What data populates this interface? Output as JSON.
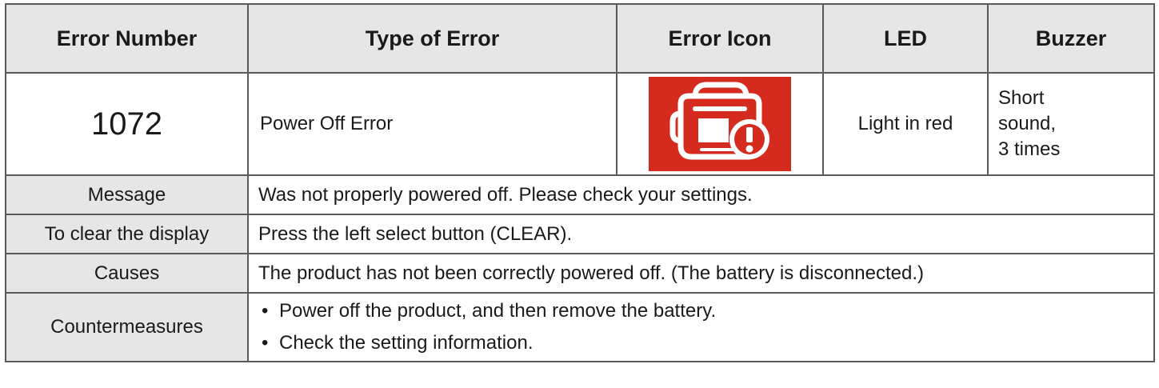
{
  "header": {
    "error_number": "Error Number",
    "type_of_error": "Type of Error",
    "error_icon": "Error Icon",
    "led": "LED",
    "buzzer": "Buzzer"
  },
  "error": {
    "number": "1072",
    "type": "Power Off Error",
    "icon": "charger-error-icon",
    "icon_color": "#d52b1e",
    "led": "Light in red",
    "buzzer_lines": [
      "Short",
      "sound,",
      "3 times"
    ]
  },
  "details": {
    "message_label": "Message",
    "message": "Was not properly powered off. Please check your settings.",
    "clear_label": "To clear the display",
    "clear": "Press the left select button (CLEAR).",
    "causes_label": "Causes",
    "causes": "The product has not been correctly powered off. (The battery is disconnected.)",
    "countermeasures_label": "Countermeasures",
    "countermeasures": [
      "Power off the product, and then remove the battery.",
      "Check the setting information."
    ]
  }
}
